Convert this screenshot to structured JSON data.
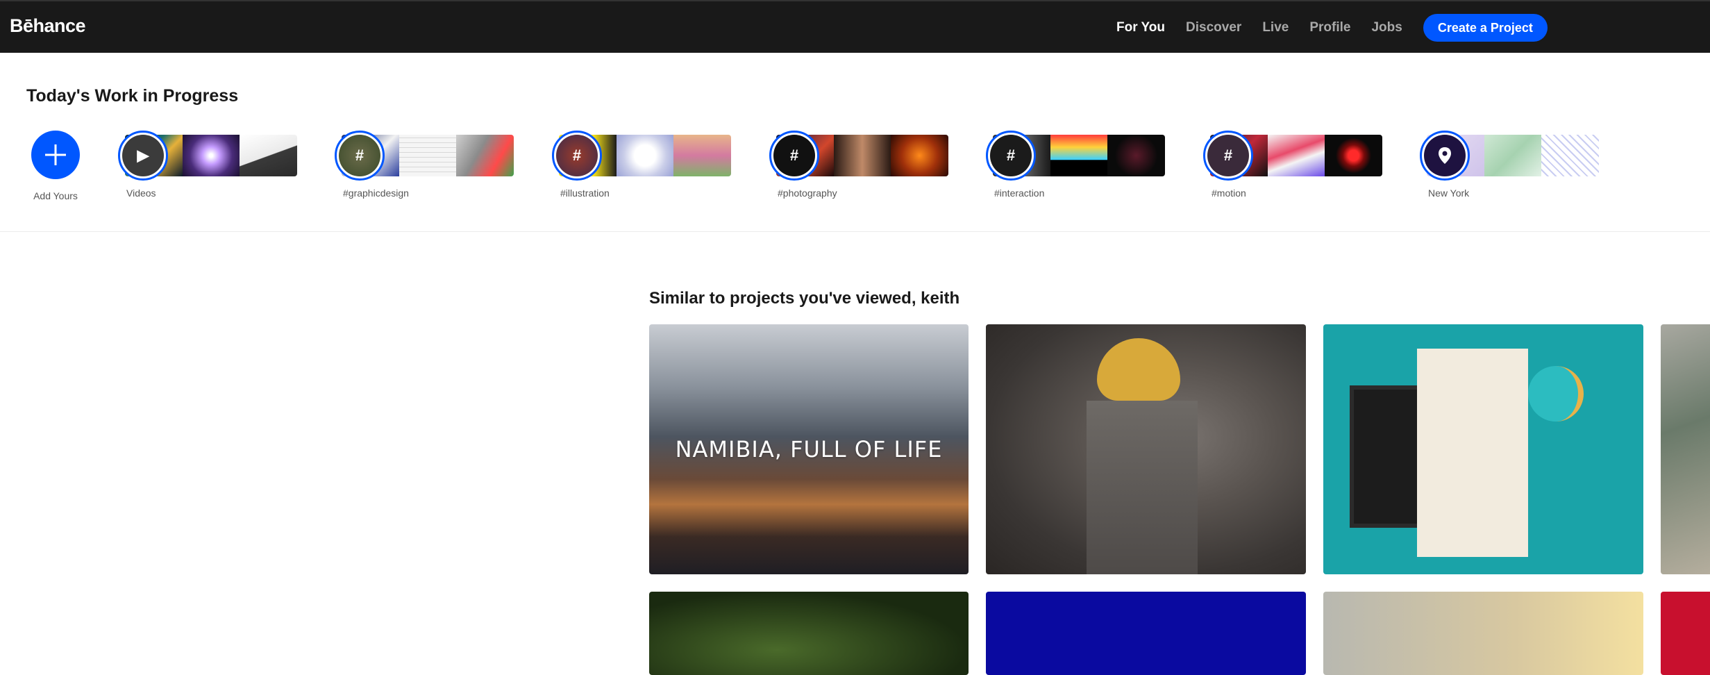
{
  "brand": {
    "logo": "Bēhance",
    "accent": "#0057ff",
    "nav_bg": "#191919"
  },
  "nav": {
    "items": [
      {
        "label": "For You",
        "active": true
      },
      {
        "label": "Discover",
        "active": false
      },
      {
        "label": "Live",
        "active": false
      },
      {
        "label": "Profile",
        "active": false
      },
      {
        "label": "Jobs",
        "active": false
      }
    ],
    "create_label": "Create a Project"
  },
  "wip": {
    "title": "Today's Work in Progress",
    "add_label": "Add Yours",
    "groups": [
      {
        "label": "Videos",
        "icon": "play-icon",
        "glyph": "▶"
      },
      {
        "label": "#graphicdesign",
        "icon": "hashtag-icon",
        "glyph": "#"
      },
      {
        "label": "#illustration",
        "icon": "hashtag-icon",
        "glyph": "#"
      },
      {
        "label": "#photography",
        "icon": "hashtag-icon",
        "glyph": "#"
      },
      {
        "label": "#interaction",
        "icon": "hashtag-icon",
        "glyph": "#"
      },
      {
        "label": "#motion",
        "icon": "hashtag-icon",
        "glyph": "#"
      },
      {
        "label": "New York",
        "icon": "location-pin-icon",
        "glyph": ""
      }
    ]
  },
  "similar": {
    "title": "Similar to projects you've viewed, keith",
    "cards": [
      {
        "overlay_text": "NAMIBIA, FULL OF LIFE"
      },
      {
        "overlay_text": ""
      },
      {
        "overlay_text": ""
      },
      {
        "overlay_text": ""
      },
      {
        "overlay_text": ""
      },
      {
        "overlay_text": ""
      },
      {
        "overlay_text": ""
      },
      {
        "overlay_text": ""
      }
    ]
  }
}
